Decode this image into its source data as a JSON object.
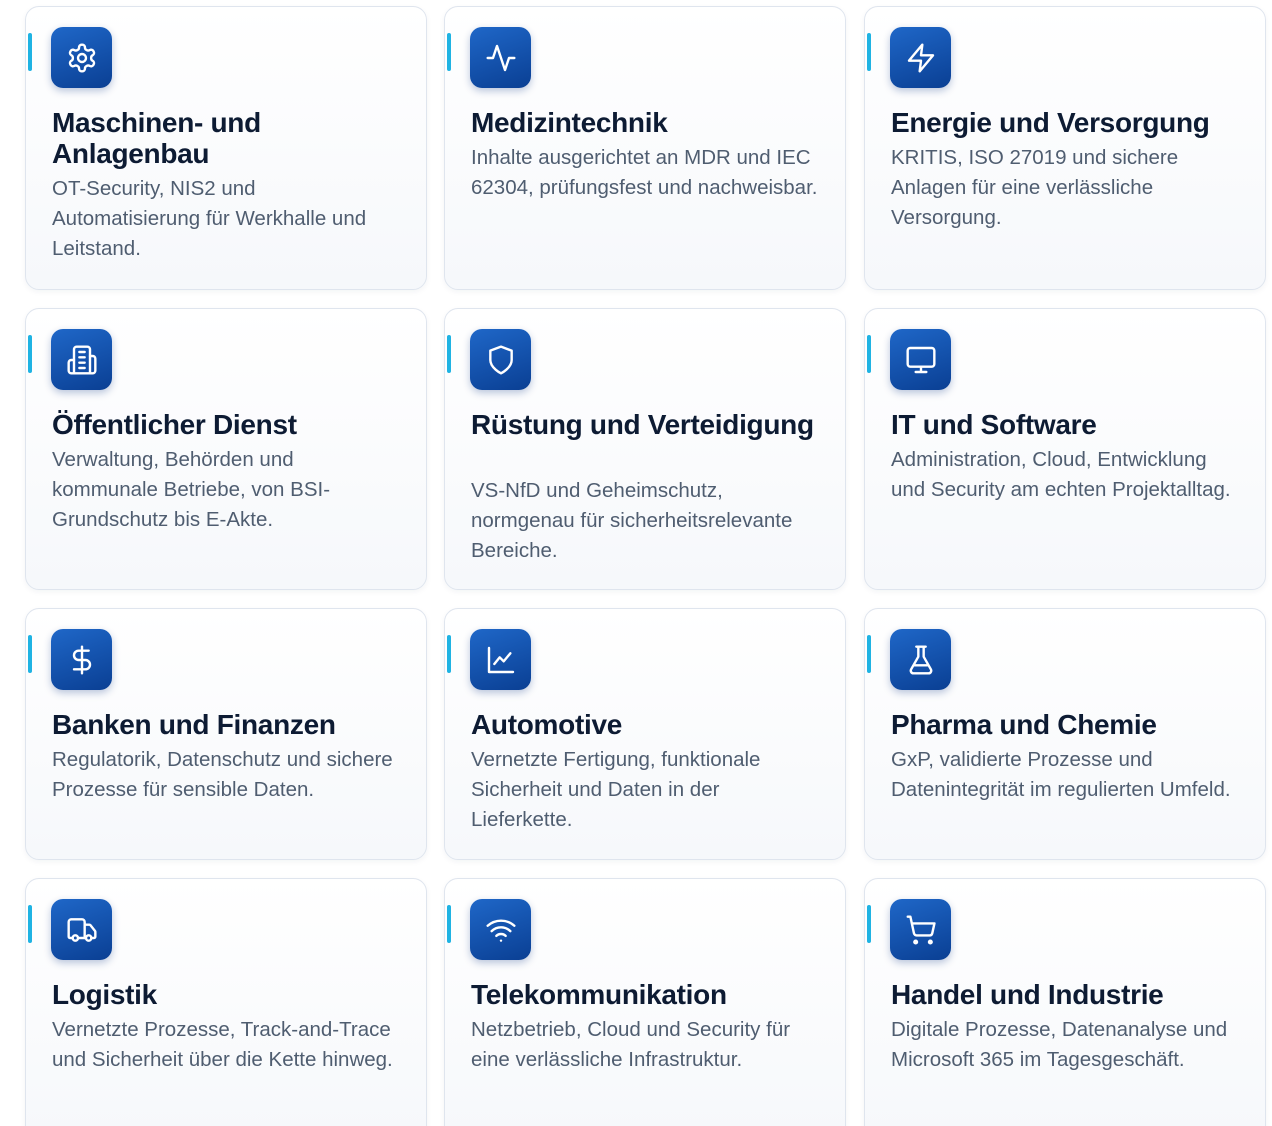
{
  "cards": [
    {
      "title": "Maschinen- und Anlagenbau",
      "desc": "OT-Security, NIS2 und Automatisierung für Werkhalle und Leitstand.",
      "icon": "gear-icon"
    },
    {
      "title": "Medizintechnik",
      "desc": "Inhalte ausgerichtet an MDR und IEC 62304, prüfungsfest und nachweisbar.",
      "icon": "pulse-icon"
    },
    {
      "title": "Energie und Versorgung",
      "desc": "KRITIS, ISO 27019 und sichere Anlagen für eine verlässliche Versorgung.",
      "icon": "lightning-icon"
    },
    {
      "title": "Öffentlicher Dienst",
      "desc": "Verwaltung, Behörden und kommunale Betriebe, von BSI-Grundschutz bis E-Akte.",
      "icon": "building-icon"
    },
    {
      "title": "Rüstung und Verteidigung",
      "desc": "VS-NfD und Geheimschutz, normgenau für sicherheitsrelevante Bereiche.",
      "icon": "shield-icon"
    },
    {
      "title": "IT und Software",
      "desc": "Administration, Cloud, Entwicklung und Security am echten Projektalltag.",
      "icon": "monitor-icon"
    },
    {
      "title": "Banken und Finanzen",
      "desc": "Regulatorik, Datenschutz und sichere Prozesse für sensible Daten.",
      "icon": "dollar-icon"
    },
    {
      "title": "Automotive",
      "desc": "Vernetzte Fertigung, funktionale Sicherheit und Daten in der Lieferkette.",
      "icon": "line-chart-icon"
    },
    {
      "title": "Pharma und Chemie",
      "desc": "GxP, validierte Prozesse und Datenintegrität im regulierten Umfeld.",
      "icon": "flask-icon"
    },
    {
      "title": "Logistik",
      "desc": "Vernetzte Prozesse, Track-and-Trace und Sicherheit über die Kette hinweg.",
      "icon": "truck-icon"
    },
    {
      "title": "Telekommunikation",
      "desc": "Netzbetrieb, Cloud und Security für eine verlässliche Infrastruktur.",
      "icon": "wifi-icon"
    },
    {
      "title": "Handel und Industrie",
      "desc": "Digitale Prozesse, Datenanalyse und Microsoft 365 im Tagesgeschäft.",
      "icon": "cart-icon"
    }
  ],
  "colors": {
    "accent": "#1fb3e3",
    "icon_bg": "#0a3f93",
    "title": "#0d1b33",
    "text": "#4f5d70",
    "border": "#dfe5ee"
  }
}
